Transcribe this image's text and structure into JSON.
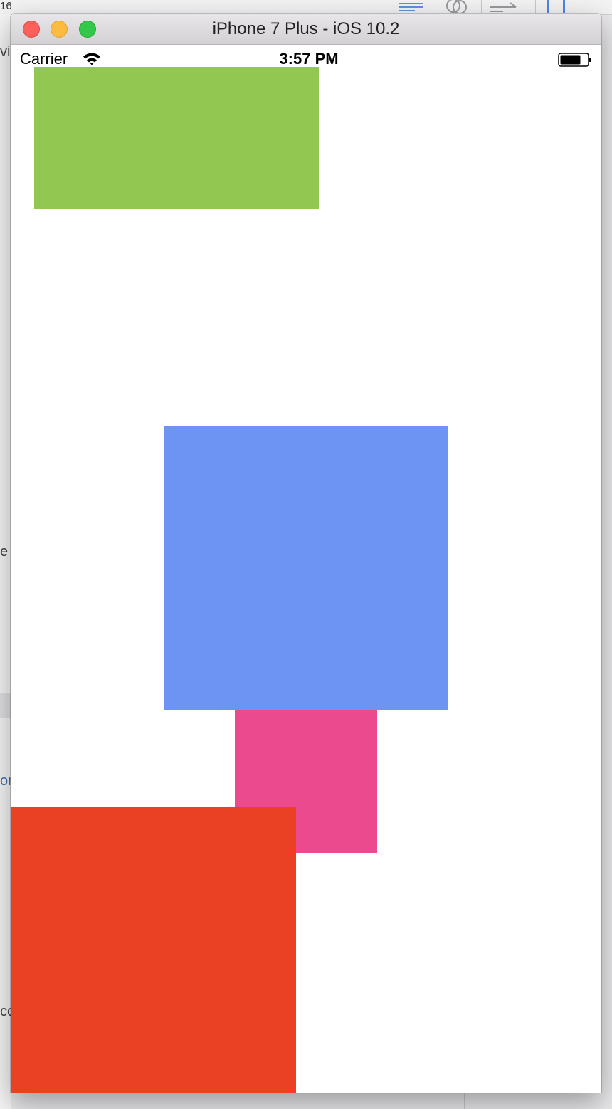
{
  "background": {
    "corner_text": "16",
    "left_fragments": [
      {
        "text": "vi"
      },
      {
        "text": "e"
      },
      {
        "text": "or"
      },
      {
        "text": "co"
      }
    ]
  },
  "simulator": {
    "window_title": "iPhone 7 Plus - iOS 10.2",
    "buttons": {
      "close": "close",
      "minimize": "minimize",
      "zoom": "zoom"
    }
  },
  "status_bar": {
    "carrier": "Carrier",
    "time": "3:57 PM",
    "wifi_icon": "wifi-icon",
    "battery_icon": "battery-icon"
  },
  "views": [
    {
      "name": "green-view",
      "color": "#92c851"
    },
    {
      "name": "blue-view",
      "color": "#6e94f3"
    },
    {
      "name": "pink-view",
      "color": "#ec4a8f"
    },
    {
      "name": "red-view",
      "color": "#ea4023"
    }
  ]
}
